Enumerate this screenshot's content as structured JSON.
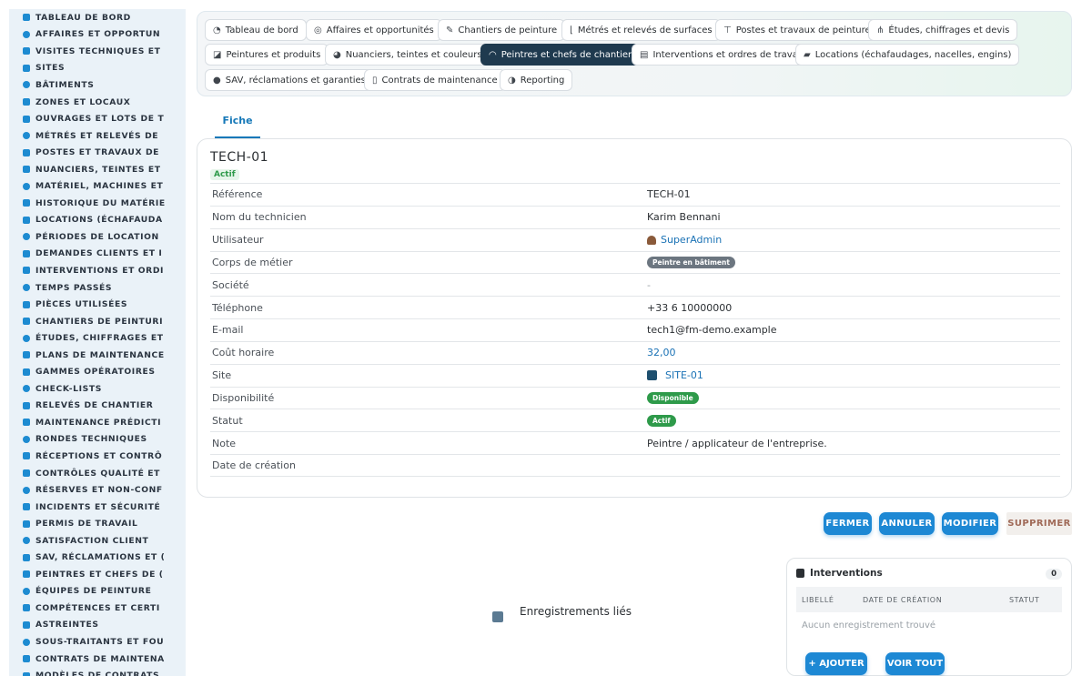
{
  "sidebar": {
    "items": [
      {
        "label": "TABLEAU DE BORD",
        "icon": "dashboard-icon"
      },
      {
        "label": "AFFAIRES ET OPPORTUN",
        "icon": "target-icon"
      },
      {
        "label": "VISITES TECHNIQUES ET",
        "icon": "calendar-icon"
      },
      {
        "label": "SITES",
        "icon": "map-pin-icon"
      },
      {
        "label": "BÂTIMENTS",
        "icon": "building-icon"
      },
      {
        "label": "ZONES ET LOCAUX",
        "icon": "layout-icon"
      },
      {
        "label": "OUVRAGES ET LOTS DE T",
        "icon": "sitemap-icon"
      },
      {
        "label": "MÉTRÉS ET RELEVÉS DE",
        "icon": "ruler-icon"
      },
      {
        "label": "POSTES ET TRAVAUX DE",
        "icon": "paint-roller-icon"
      },
      {
        "label": "NUANCIERS, TEINTES ET",
        "icon": "palette-icon"
      },
      {
        "label": "MATÉRIEL, MACHINES ET",
        "icon": "cogs-icon"
      },
      {
        "label": "HISTORIQUE DU MATÉRIE",
        "icon": "history-icon"
      },
      {
        "label": "LOCATIONS (ÉCHAFAUDA",
        "icon": "truck-icon"
      },
      {
        "label": "PÉRIODES DE LOCATION",
        "icon": "calendar-range-icon"
      },
      {
        "label": "DEMANDES CLIENTS ET I",
        "icon": "question-icon"
      },
      {
        "label": "INTERVENTIONS ET ORDI",
        "icon": "clipboard-icon"
      },
      {
        "label": "TEMPS PASSÉS",
        "icon": "clock-icon"
      },
      {
        "label": "PIÈCES UTILISÉES",
        "icon": "list-icon"
      },
      {
        "label": "CHANTIERS DE PEINTURI",
        "icon": "brush-icon"
      },
      {
        "label": "ÉTUDES, CHIFFRAGES ET",
        "icon": "calculator-icon"
      },
      {
        "label": "PLANS DE MAINTENANCE",
        "icon": "calendar-check-icon"
      },
      {
        "label": "GAMMES OPÉRATOIRES",
        "icon": "list-ordered-icon"
      },
      {
        "label": "CHECK-LISTS",
        "icon": "checklist-icon"
      },
      {
        "label": "RELEVÉS DE CHANTIER",
        "icon": "thermometer-icon"
      },
      {
        "label": "MAINTENANCE PRÉDICTI",
        "icon": "chart-line-icon"
      },
      {
        "label": "RONDES TECHNIQUES",
        "icon": "route-icon"
      },
      {
        "label": "RÉCEPTIONS ET CONTRÔ",
        "icon": "search-icon"
      },
      {
        "label": "CONTRÔLES QUALITÉ ET",
        "icon": "clipboard-check-icon"
      },
      {
        "label": "RÉSERVES ET NON-CONF",
        "icon": "alert-circle-icon"
      },
      {
        "label": "INCIDENTS ET SÉCURITÉ",
        "icon": "warning-icon"
      },
      {
        "label": "PERMIS DE TRAVAIL",
        "icon": "file-signature-icon"
      },
      {
        "label": "SATISFACTION CLIENT",
        "icon": "smile-icon"
      },
      {
        "label": "SAV, RÉCLAMATIONS ET (",
        "icon": "comment-icon"
      },
      {
        "label": "PEINTRES ET CHEFS DE (",
        "icon": "hard-hat-icon"
      },
      {
        "label": "ÉQUIPES DE PEINTURE",
        "icon": "users-icon"
      },
      {
        "label": "COMPÉTENCES ET CERTI",
        "icon": "certificate-icon"
      },
      {
        "label": "ASTREINTES",
        "icon": "phone-icon"
      },
      {
        "label": "SOUS-TRAITANTS ET FOU",
        "icon": "handshake-icon"
      },
      {
        "label": "CONTRATS DE MAINTENA",
        "icon": "file-contract-icon"
      },
      {
        "label": "MODÈLES DE CONTRATS",
        "icon": "file-icon"
      }
    ]
  },
  "tabs": [
    {
      "label": "Tableau de bord",
      "icon": "dashboard-icon",
      "glyph": "◔",
      "active": false
    },
    {
      "label": "Affaires et opportunités",
      "icon": "target-icon",
      "glyph": "◎",
      "active": false
    },
    {
      "label": "Chantiers de peinture",
      "icon": "brush-icon",
      "glyph": "✎",
      "active": false
    },
    {
      "label": "Métrés et relevés de surfaces",
      "icon": "ruler-icon",
      "glyph": "⌊",
      "active": false
    },
    {
      "label": "Postes et travaux de peinture",
      "icon": "paint-roller-icon",
      "glyph": "⊤",
      "active": false
    },
    {
      "label": "Études, chiffrages et devis",
      "icon": "sitemap-icon",
      "glyph": "⋔",
      "active": false
    },
    {
      "label": "Peintures et produits",
      "icon": "fill-drip-icon",
      "glyph": "◪",
      "active": false
    },
    {
      "label": "Nuanciers, teintes et couleurs",
      "icon": "palette-icon",
      "glyph": "◕",
      "active": false
    },
    {
      "label": "Peintres et chefs de chantier",
      "icon": "hard-hat-icon",
      "glyph": "◠",
      "active": true
    },
    {
      "label": "Interventions et ordres de travail",
      "icon": "clipboard-icon",
      "glyph": "▤",
      "active": false
    },
    {
      "label": "Locations (échafaudages, nacelles, engins)",
      "icon": "truck-icon",
      "glyph": "▰",
      "active": false
    },
    {
      "label": "SAV, réclamations et garanties",
      "icon": "comment-icon",
      "glyph": "●",
      "active": false
    },
    {
      "label": "Contrats de maintenance",
      "icon": "file-contract-icon",
      "glyph": "▯",
      "active": false
    },
    {
      "label": "Reporting",
      "icon": "pie-chart-icon",
      "glyph": "◑",
      "active": false
    }
  ],
  "fiche_tab": "Fiche",
  "record": {
    "title": "TECH-01",
    "status_small": "Actif",
    "fields": [
      {
        "label": "Référence",
        "value": "TECH-01",
        "type": "text"
      },
      {
        "label": "Nom du technicien",
        "value": "Karim Bennani",
        "type": "text"
      },
      {
        "label": "Utilisateur",
        "value": "SuperAdmin",
        "type": "user-link",
        "icon": "user-icon"
      },
      {
        "label": "Corps de métier",
        "value": "Peintre en bâtiment",
        "type": "badge-gray"
      },
      {
        "label": "Société",
        "value": "-",
        "type": "muted"
      },
      {
        "label": "Téléphone",
        "value": "+33 6 10000000",
        "type": "text"
      },
      {
        "label": "E-mail",
        "value": "tech1@fm-demo.example",
        "type": "text"
      },
      {
        "label": "Coût horaire",
        "value": "32,00",
        "type": "link"
      },
      {
        "label": "Site",
        "value": "SITE-01",
        "type": "site-link",
        "icon": "building-icon"
      },
      {
        "label": "Disponibilité",
        "value": "Disponible",
        "type": "badge-green"
      },
      {
        "label": "Statut",
        "value": "Actif",
        "type": "badge-green"
      },
      {
        "label": "Note",
        "value": "Peintre / applicateur de l'entreprise.",
        "type": "text"
      },
      {
        "label": "Date de création",
        "value": "",
        "type": "text"
      }
    ]
  },
  "actions": {
    "close": "FERMER",
    "cancel": "ANNULER",
    "edit": "MODIFIER",
    "delete": "SUPPRIMER"
  },
  "related": {
    "label": "Enregistrements liés",
    "panel": {
      "title": "Interventions",
      "count": "0",
      "columns": [
        "LIBELLÉ",
        "DATE DE CRÉATION",
        "STATUT"
      ],
      "empty": "Aucun enregistrement trouvé",
      "add": "+ AJOUTER",
      "view_all": "VOIR TOUT"
    }
  },
  "colors": {
    "accent": "#1d88d4",
    "active_tab": "#1f3a4f",
    "success": "#2e9a4a",
    "sidebar_bg": "#eaf2f8"
  }
}
